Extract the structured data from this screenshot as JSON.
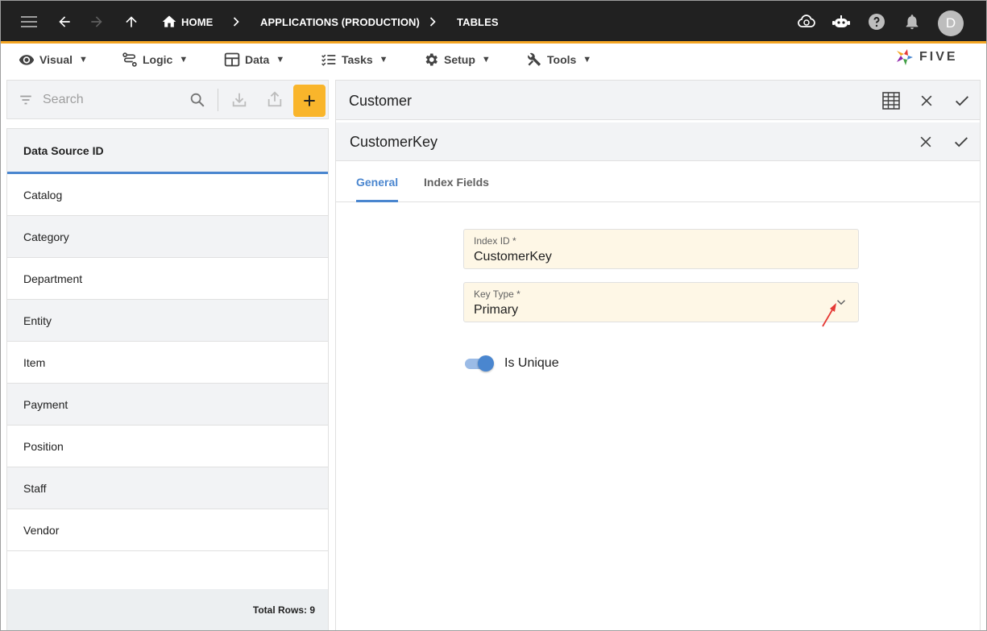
{
  "appbar": {
    "breadcrumbs": [
      "HOME",
      "APPLICATIONS (PRODUCTION)",
      "TABLES"
    ],
    "avatar_initial": "D"
  },
  "menu": [
    {
      "label": "Visual",
      "icon": "eye-icon"
    },
    {
      "label": "Logic",
      "icon": "flow-icon"
    },
    {
      "label": "Data",
      "icon": "table-icon"
    },
    {
      "label": "Tasks",
      "icon": "checklist-icon"
    },
    {
      "label": "Setup",
      "icon": "gear-icon"
    },
    {
      "label": "Tools",
      "icon": "tools-icon"
    }
  ],
  "menu_caret": "▼",
  "logo": {
    "text": "FIVE"
  },
  "search": {
    "placeholder": "Search"
  },
  "list": {
    "header": "Data Source ID",
    "rows": [
      "Catalog",
      "Category",
      "Department",
      "Entity",
      "Item",
      "Payment",
      "Position",
      "Staff",
      "Vendor"
    ],
    "footer": "Total Rows: 9"
  },
  "detail": {
    "title": "Customer",
    "sub_title": "CustomerKey",
    "tabs": [
      "General",
      "Index Fields"
    ],
    "active_tab": "General",
    "fields": {
      "index_id": {
        "label": "Index ID *",
        "value": "CustomerKey"
      },
      "key_type": {
        "label": "Key Type *",
        "value": "Primary"
      }
    },
    "is_unique": {
      "label": "Is Unique",
      "on": true
    }
  },
  "colors": {
    "appbar": "#212121",
    "accent_border": "#f5a623",
    "add_button": "#f9b52b",
    "primary": "#4a86cf",
    "field_bg": "#fef7e6",
    "annotation_arrow": "#e53935"
  }
}
